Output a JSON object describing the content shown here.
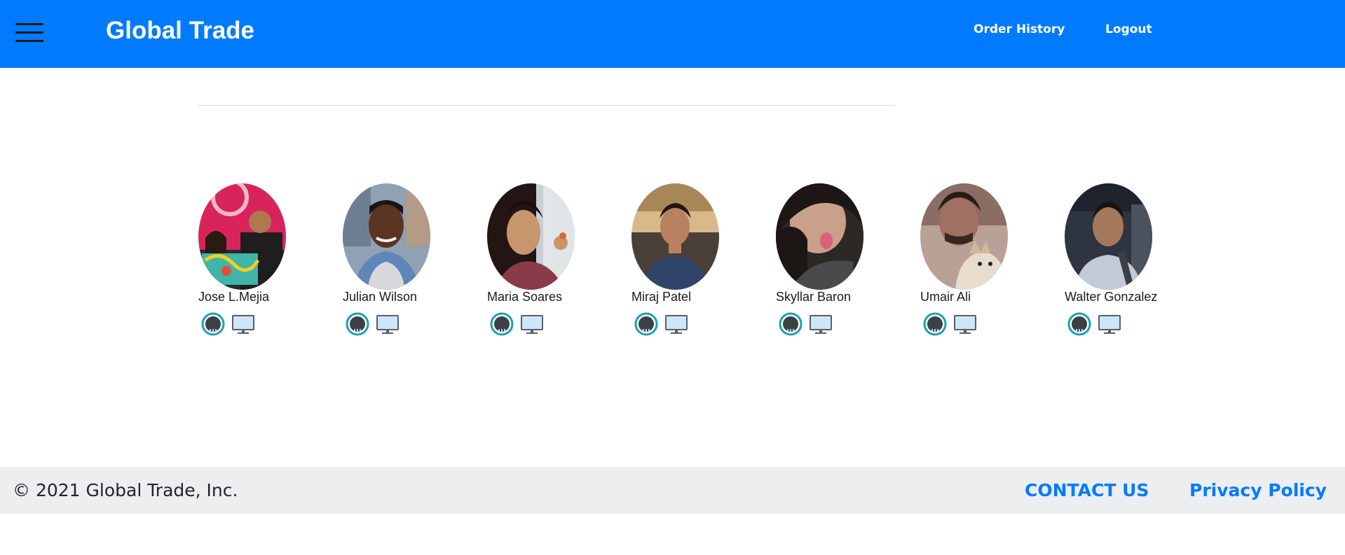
{
  "header": {
    "brand": "Global Trade",
    "nav": {
      "order_history": "Order History",
      "logout": "Logout"
    }
  },
  "team": {
    "members": [
      {
        "name": "Jose L.Mejia"
      },
      {
        "name": "Julian Wilson"
      },
      {
        "name": "Maria Soares"
      },
      {
        "name": "Miraj Patel"
      },
      {
        "name": "Skyllar Baron"
      },
      {
        "name": "Umair Ali"
      },
      {
        "name": "Walter Gonzalez"
      }
    ],
    "icons": {
      "github": "github-icon",
      "portfolio": "monitor-icon"
    }
  },
  "footer": {
    "copyright": "© 2021 Global Trade, Inc.",
    "contact": "CONTACT US",
    "privacy": "Privacy Policy"
  },
  "colors": {
    "header_bg": "#007bff",
    "footer_bg": "#eceeef",
    "link": "#007bff",
    "github_ring": "#17a2b8"
  }
}
